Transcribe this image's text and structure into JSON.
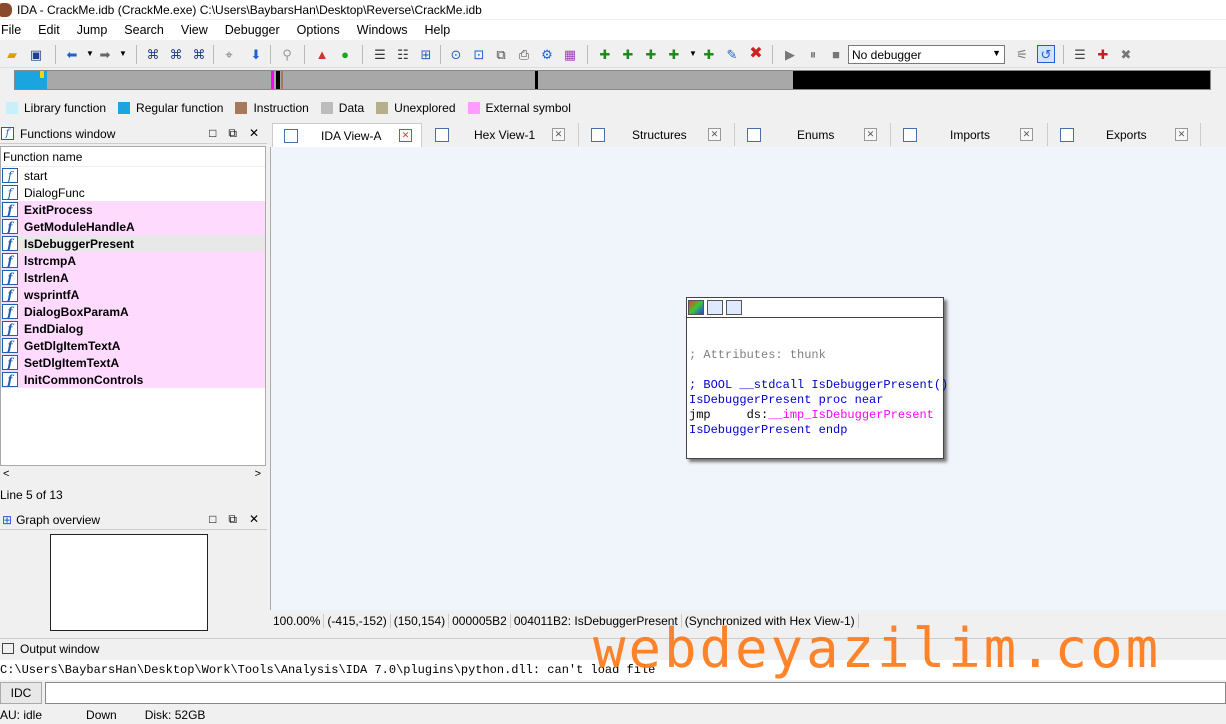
{
  "title": "IDA - CrackMe.idb (CrackMe.exe) C:\\Users\\BaybarsHan\\Desktop\\Reverse\\CrackMe.idb",
  "menu": [
    "File",
    "Edit",
    "Jump",
    "Search",
    "View",
    "Debugger",
    "Options",
    "Windows",
    "Help"
  ],
  "toolbar": {
    "debugger_select": "No debugger"
  },
  "legend": [
    {
      "label": "Library function",
      "color": "#c8f0f8"
    },
    {
      "label": "Regular function",
      "color": "#1aa5e0"
    },
    {
      "label": "Instruction",
      "color": "#a8785a"
    },
    {
      "label": "Data",
      "color": "#bcbcbc"
    },
    {
      "label": "Unexplored",
      "color": "#b5b08a"
    },
    {
      "label": "External symbol",
      "color": "#ff9cff"
    }
  ],
  "functions_window": {
    "title": "Functions window",
    "column": "Function name",
    "items": [
      {
        "name": "start",
        "kind": "regular"
      },
      {
        "name": "DialogFunc",
        "kind": "regular"
      },
      {
        "name": "ExitProcess",
        "kind": "external"
      },
      {
        "name": "GetModuleHandleA",
        "kind": "external"
      },
      {
        "name": "IsDebuggerPresent",
        "kind": "selected"
      },
      {
        "name": "lstrcmpA",
        "kind": "external"
      },
      {
        "name": "lstrlenA",
        "kind": "external"
      },
      {
        "name": "wsprintfA",
        "kind": "external"
      },
      {
        "name": "DialogBoxParamA",
        "kind": "external"
      },
      {
        "name": "EndDialog",
        "kind": "external"
      },
      {
        "name": "GetDlgItemTextA",
        "kind": "external"
      },
      {
        "name": "SetDlgItemTextA",
        "kind": "external"
      },
      {
        "name": "InitCommonControls",
        "kind": "external"
      }
    ],
    "status": "Line 5 of 13"
  },
  "graph_overview": {
    "title": "Graph overview"
  },
  "tabs": [
    {
      "label": "IDA View-A",
      "active": true
    },
    {
      "label": "Hex View-1"
    },
    {
      "label": "Structures"
    },
    {
      "label": "Enums"
    },
    {
      "label": "Imports"
    },
    {
      "label": "Exports"
    }
  ],
  "node": {
    "attr": "; Attributes: thunk",
    "proto": "; BOOL __stdcall IsDebuggerPresent()",
    "proc": "IsDebuggerPresent proc near",
    "jmp_op": "jmp     ds:",
    "jmp_target": "__imp_IsDebuggerPresent",
    "endp": "IsDebuggerPresent endp"
  },
  "view_status": [
    "100.00%",
    "(-415,-152)",
    "(150,154)",
    "000005B2",
    "004011B2: IsDebuggerPresent",
    "(Synchronized with Hex View-1)"
  ],
  "output": {
    "title": "Output window",
    "line": "C:\\Users\\BaybarsHan\\Desktop\\Work\\Tools\\Analysis\\IDA 7.0\\plugins\\python.dll: can't load file"
  },
  "idc_label": "IDC",
  "statusbar": [
    "AU:  idle",
    "Down",
    "Disk: 52GB"
  ],
  "watermark": "webdeyazilim.com"
}
